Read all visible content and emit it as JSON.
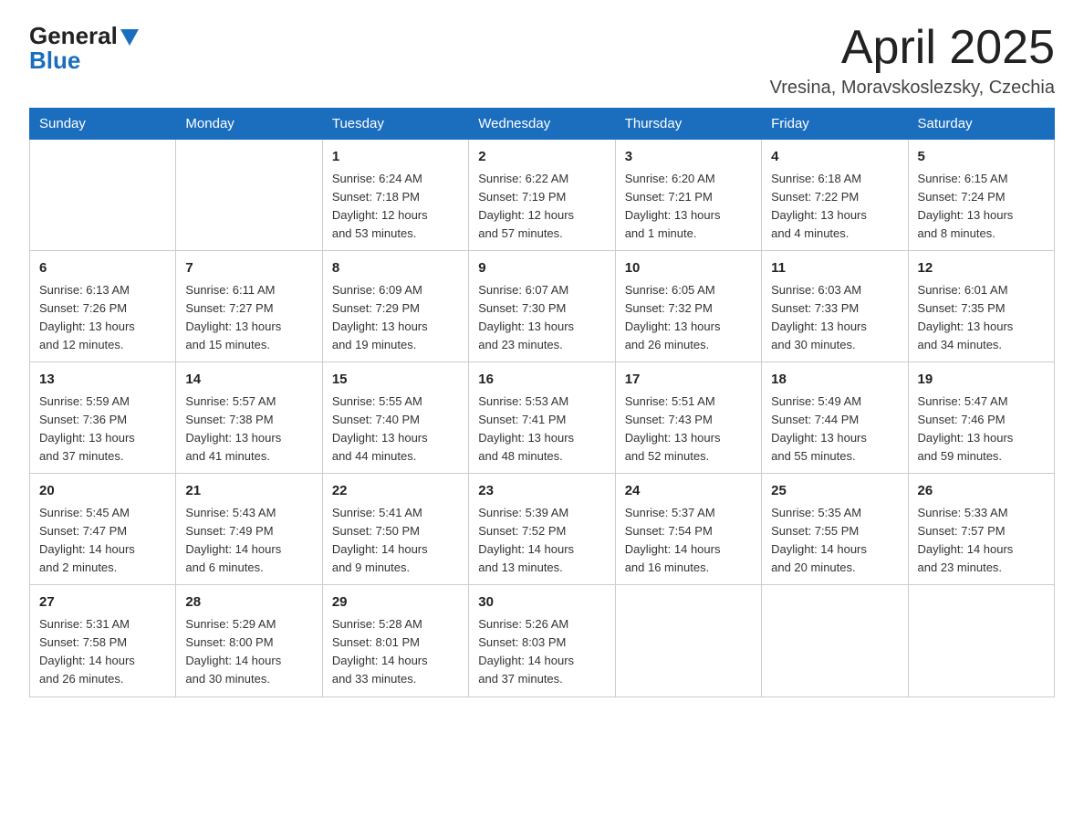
{
  "header": {
    "logo_general": "General",
    "logo_blue": "Blue",
    "month_title": "April 2025",
    "location": "Vresina, Moravskoslezsky, Czechia"
  },
  "weekdays": [
    "Sunday",
    "Monday",
    "Tuesday",
    "Wednesday",
    "Thursday",
    "Friday",
    "Saturday"
  ],
  "weeks": [
    [
      {
        "day": "",
        "info": ""
      },
      {
        "day": "",
        "info": ""
      },
      {
        "day": "1",
        "info": "Sunrise: 6:24 AM\nSunset: 7:18 PM\nDaylight: 12 hours\nand 53 minutes."
      },
      {
        "day": "2",
        "info": "Sunrise: 6:22 AM\nSunset: 7:19 PM\nDaylight: 12 hours\nand 57 minutes."
      },
      {
        "day": "3",
        "info": "Sunrise: 6:20 AM\nSunset: 7:21 PM\nDaylight: 13 hours\nand 1 minute."
      },
      {
        "day": "4",
        "info": "Sunrise: 6:18 AM\nSunset: 7:22 PM\nDaylight: 13 hours\nand 4 minutes."
      },
      {
        "day": "5",
        "info": "Sunrise: 6:15 AM\nSunset: 7:24 PM\nDaylight: 13 hours\nand 8 minutes."
      }
    ],
    [
      {
        "day": "6",
        "info": "Sunrise: 6:13 AM\nSunset: 7:26 PM\nDaylight: 13 hours\nand 12 minutes."
      },
      {
        "day": "7",
        "info": "Sunrise: 6:11 AM\nSunset: 7:27 PM\nDaylight: 13 hours\nand 15 minutes."
      },
      {
        "day": "8",
        "info": "Sunrise: 6:09 AM\nSunset: 7:29 PM\nDaylight: 13 hours\nand 19 minutes."
      },
      {
        "day": "9",
        "info": "Sunrise: 6:07 AM\nSunset: 7:30 PM\nDaylight: 13 hours\nand 23 minutes."
      },
      {
        "day": "10",
        "info": "Sunrise: 6:05 AM\nSunset: 7:32 PM\nDaylight: 13 hours\nand 26 minutes."
      },
      {
        "day": "11",
        "info": "Sunrise: 6:03 AM\nSunset: 7:33 PM\nDaylight: 13 hours\nand 30 minutes."
      },
      {
        "day": "12",
        "info": "Sunrise: 6:01 AM\nSunset: 7:35 PM\nDaylight: 13 hours\nand 34 minutes."
      }
    ],
    [
      {
        "day": "13",
        "info": "Sunrise: 5:59 AM\nSunset: 7:36 PM\nDaylight: 13 hours\nand 37 minutes."
      },
      {
        "day": "14",
        "info": "Sunrise: 5:57 AM\nSunset: 7:38 PM\nDaylight: 13 hours\nand 41 minutes."
      },
      {
        "day": "15",
        "info": "Sunrise: 5:55 AM\nSunset: 7:40 PM\nDaylight: 13 hours\nand 44 minutes."
      },
      {
        "day": "16",
        "info": "Sunrise: 5:53 AM\nSunset: 7:41 PM\nDaylight: 13 hours\nand 48 minutes."
      },
      {
        "day": "17",
        "info": "Sunrise: 5:51 AM\nSunset: 7:43 PM\nDaylight: 13 hours\nand 52 minutes."
      },
      {
        "day": "18",
        "info": "Sunrise: 5:49 AM\nSunset: 7:44 PM\nDaylight: 13 hours\nand 55 minutes."
      },
      {
        "day": "19",
        "info": "Sunrise: 5:47 AM\nSunset: 7:46 PM\nDaylight: 13 hours\nand 59 minutes."
      }
    ],
    [
      {
        "day": "20",
        "info": "Sunrise: 5:45 AM\nSunset: 7:47 PM\nDaylight: 14 hours\nand 2 minutes."
      },
      {
        "day": "21",
        "info": "Sunrise: 5:43 AM\nSunset: 7:49 PM\nDaylight: 14 hours\nand 6 minutes."
      },
      {
        "day": "22",
        "info": "Sunrise: 5:41 AM\nSunset: 7:50 PM\nDaylight: 14 hours\nand 9 minutes."
      },
      {
        "day": "23",
        "info": "Sunrise: 5:39 AM\nSunset: 7:52 PM\nDaylight: 14 hours\nand 13 minutes."
      },
      {
        "day": "24",
        "info": "Sunrise: 5:37 AM\nSunset: 7:54 PM\nDaylight: 14 hours\nand 16 minutes."
      },
      {
        "day": "25",
        "info": "Sunrise: 5:35 AM\nSunset: 7:55 PM\nDaylight: 14 hours\nand 20 minutes."
      },
      {
        "day": "26",
        "info": "Sunrise: 5:33 AM\nSunset: 7:57 PM\nDaylight: 14 hours\nand 23 minutes."
      }
    ],
    [
      {
        "day": "27",
        "info": "Sunrise: 5:31 AM\nSunset: 7:58 PM\nDaylight: 14 hours\nand 26 minutes."
      },
      {
        "day": "28",
        "info": "Sunrise: 5:29 AM\nSunset: 8:00 PM\nDaylight: 14 hours\nand 30 minutes."
      },
      {
        "day": "29",
        "info": "Sunrise: 5:28 AM\nSunset: 8:01 PM\nDaylight: 14 hours\nand 33 minutes."
      },
      {
        "day": "30",
        "info": "Sunrise: 5:26 AM\nSunset: 8:03 PM\nDaylight: 14 hours\nand 37 minutes."
      },
      {
        "day": "",
        "info": ""
      },
      {
        "day": "",
        "info": ""
      },
      {
        "day": "",
        "info": ""
      }
    ]
  ]
}
